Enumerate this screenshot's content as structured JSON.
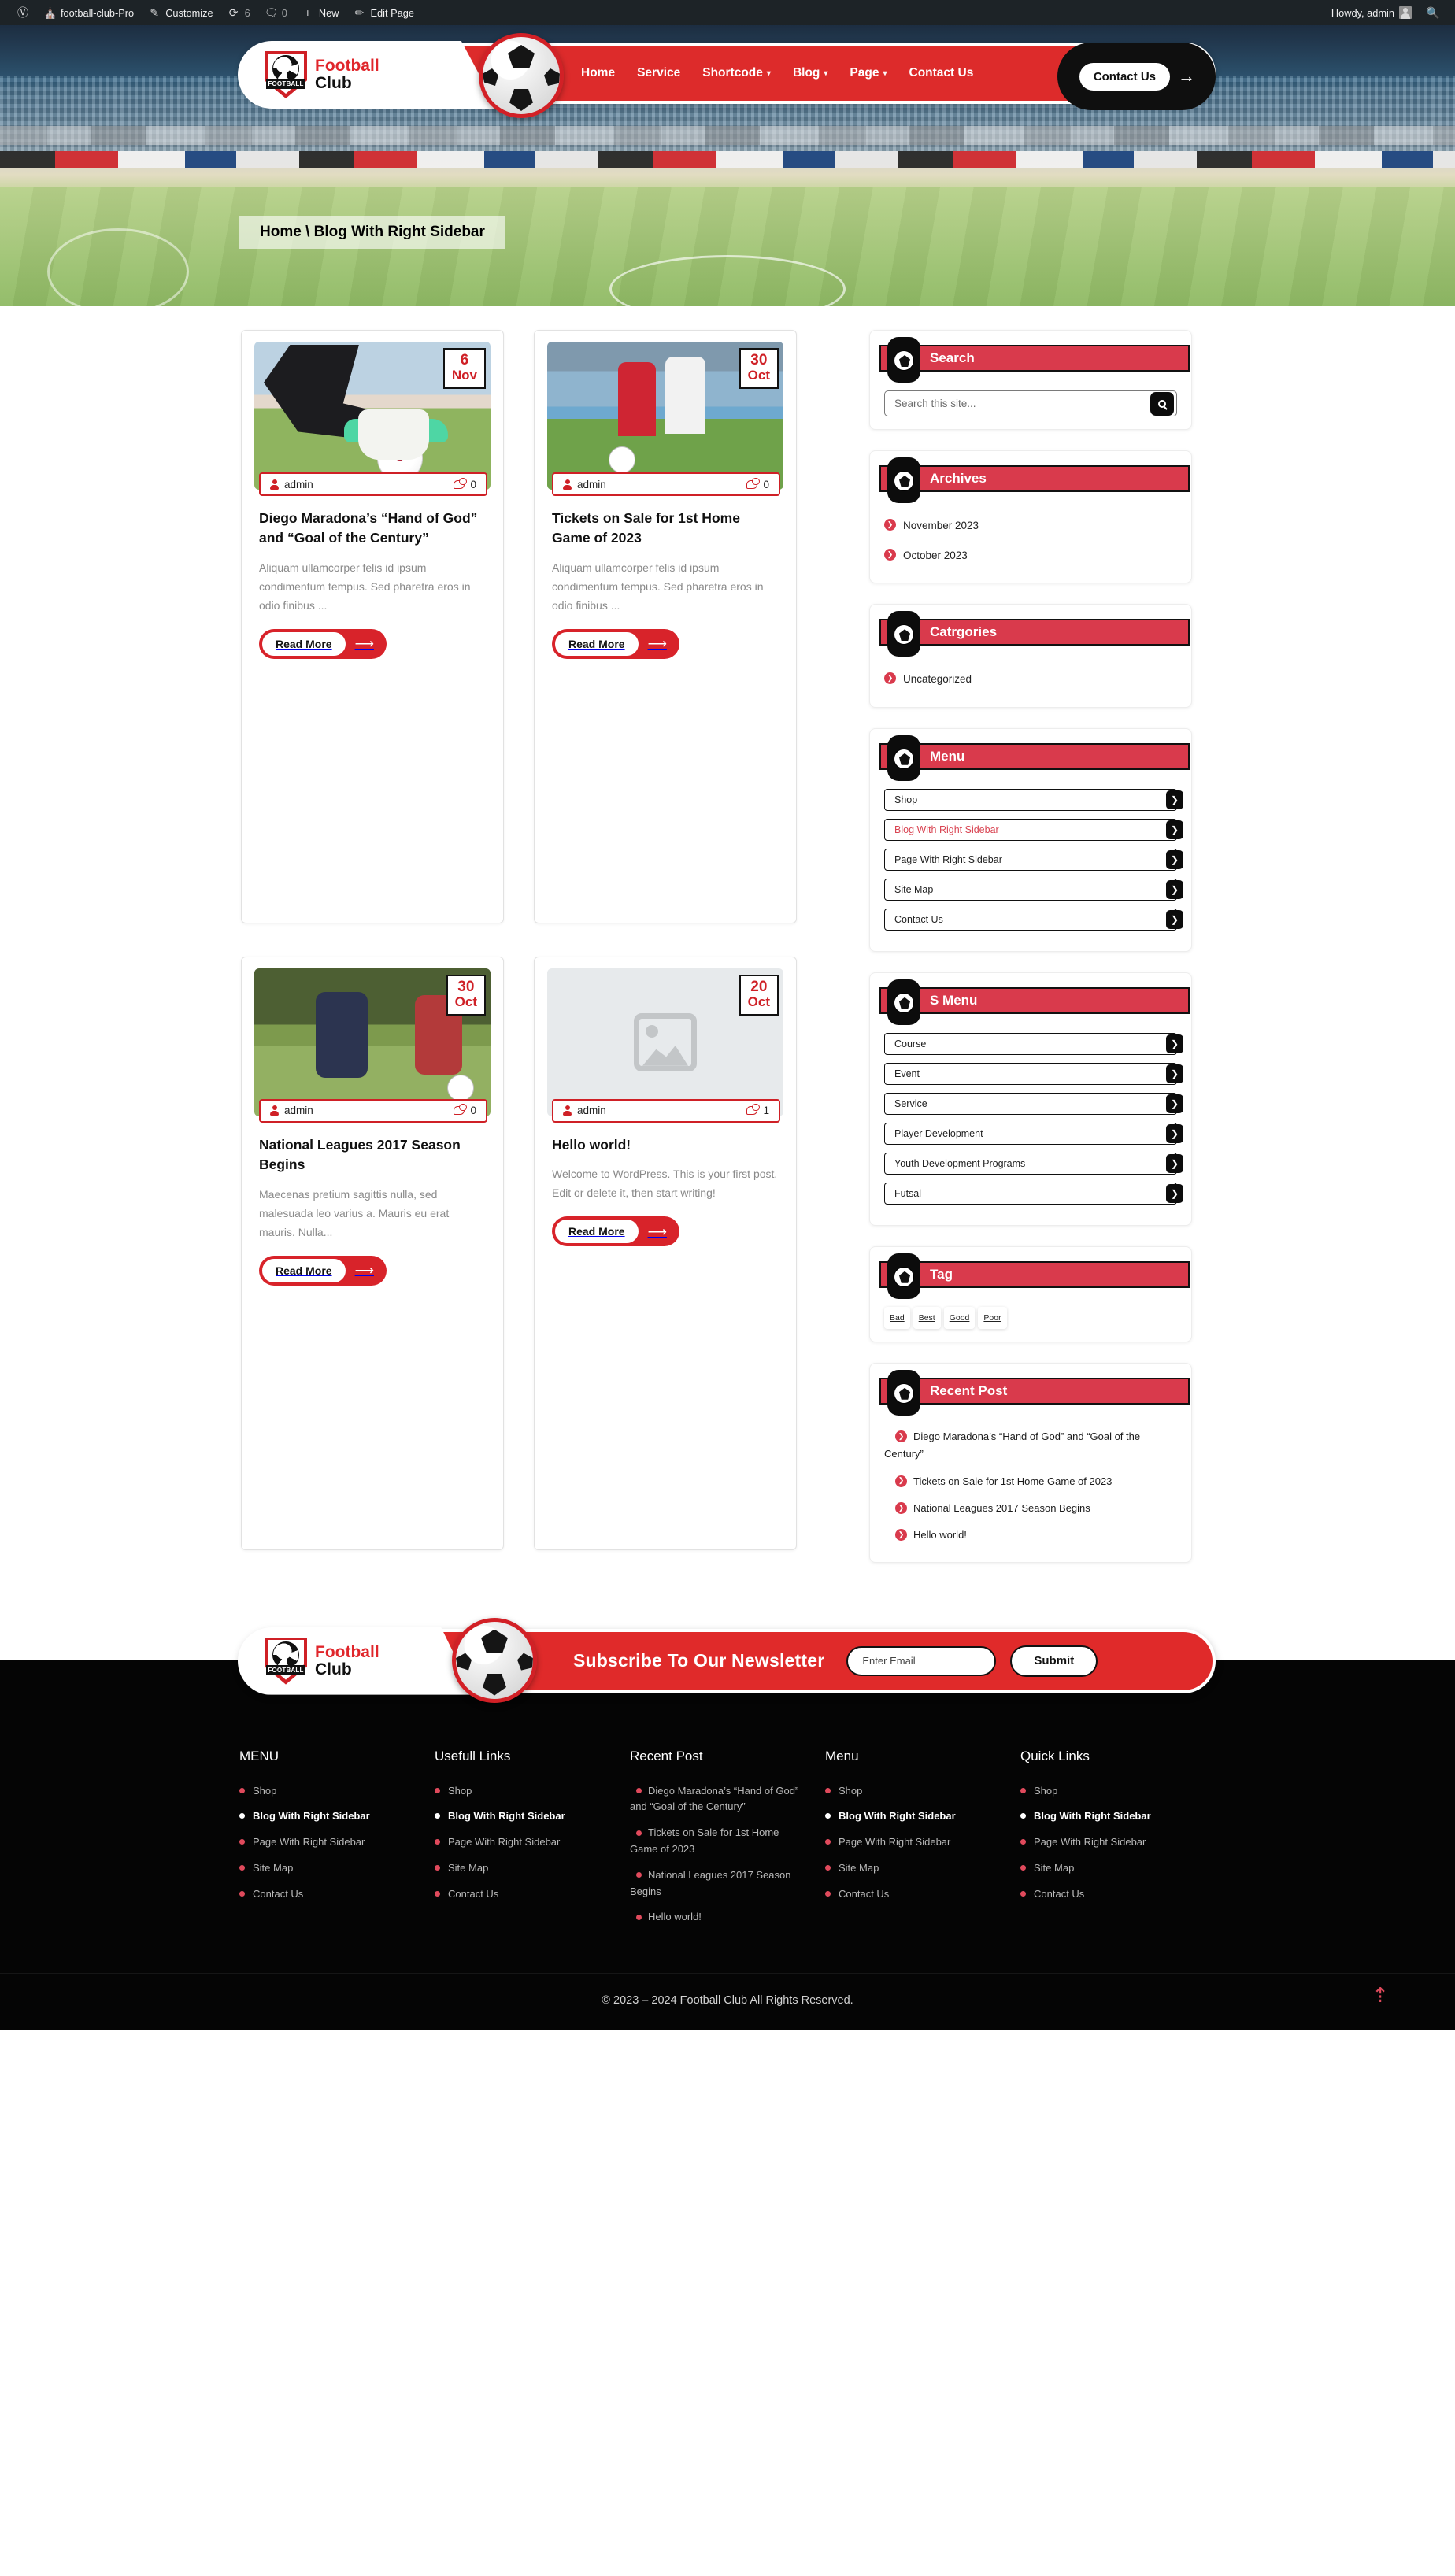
{
  "adminbar": {
    "wp_logo": "wordpress-icon",
    "site_name": "football-club-Pro",
    "customize": "Customize",
    "revisions_count": "6",
    "comments_count": "0",
    "new": "New",
    "edit_page": "Edit Page",
    "howdy": "Howdy, admin",
    "search": "search-icon"
  },
  "header": {
    "logo_line1": "Football",
    "logo_line2": "Club",
    "crest_word": "FOOTBALL",
    "nav": [
      {
        "label": "Home",
        "has_caret": false
      },
      {
        "label": "Service",
        "has_caret": false
      },
      {
        "label": "Shortcode",
        "has_caret": true
      },
      {
        "label": "Blog",
        "has_caret": true
      },
      {
        "label": "Page",
        "has_caret": true
      },
      {
        "label": "Contact Us",
        "has_caret": false
      }
    ],
    "cta_label": "Contact Us",
    "cta_arrow": "→"
  },
  "breadcrumb": "Home \\ Blog With Right Sidebar",
  "posts": [
    {
      "day": "6",
      "month": "Nov",
      "author": "admin",
      "comments": "0",
      "title": "Diego Maradona’s “Hand of God” and “Goal of the Century”",
      "excerpt": "Aliquam ullamcorper felis id ipsum condimentum tempus. Sed pharetra eros in odio finibus ...",
      "read_more": "Read More",
      "arrow": "⟶"
    },
    {
      "day": "30",
      "month": "Oct",
      "author": "admin",
      "comments": "0",
      "title": "Tickets on Sale for 1st Home Game of 2023",
      "excerpt": "Aliquam ullamcorper felis id ipsum condimentum tempus. Sed pharetra eros in odio finibus ...",
      "read_more": "Read More",
      "arrow": "⟶"
    },
    {
      "day": "30",
      "month": "Oct",
      "author": "admin",
      "comments": "0",
      "title": "National Leagues 2017 Season Begins",
      "excerpt": "Maecenas pretium sagittis nulla, sed malesuada leo varius a. Mauris eu erat mauris. Nulla...",
      "read_more": "Read More",
      "arrow": "⟶"
    },
    {
      "day": "20",
      "month": "Oct",
      "author": "admin",
      "comments": "1",
      "title": "Hello world!",
      "excerpt": "Welcome to WordPress. This is your first post. Edit or delete it, then start writing!",
      "read_more": "Read More",
      "arrow": "⟶"
    }
  ],
  "sidebar": {
    "search": {
      "title": "Search",
      "placeholder": "Search this site...",
      "button": "search-icon"
    },
    "archives": {
      "title": "Archives",
      "items": [
        "November 2023",
        "October 2023"
      ]
    },
    "categories": {
      "title": "Catrgories",
      "items": [
        "Uncategorized"
      ]
    },
    "menu": {
      "title": "Menu",
      "items": [
        {
          "label": "Shop",
          "active": false
        },
        {
          "label": "Blog With Right Sidebar",
          "active": true
        },
        {
          "label": "Page With Right Sidebar",
          "active": false
        },
        {
          "label": "Site Map",
          "active": false
        },
        {
          "label": "Contact Us",
          "active": false
        }
      ]
    },
    "smenu": {
      "title": "S Menu",
      "items": [
        {
          "label": "Course"
        },
        {
          "label": "Event"
        },
        {
          "label": "Service"
        },
        {
          "label": "Player Development"
        },
        {
          "label": "Youth Development Programs"
        },
        {
          "label": "Futsal"
        }
      ]
    },
    "tag": {
      "title": "Tag",
      "items": [
        "Bad",
        "Best",
        "Good",
        "Poor"
      ]
    },
    "recent": {
      "title": "Recent Post",
      "items": [
        "Diego Maradona’s “Hand of God” and “Goal of the Century”",
        "Tickets on Sale for 1st Home Game of 2023",
        "National Leagues 2017 Season Begins",
        "Hello world!"
      ]
    }
  },
  "newsletter": {
    "logo_line1": "Football",
    "logo_line2": "Club",
    "title": "Subscribe To Our Newsletter",
    "email_placeholder": "Enter Email",
    "submit": "Submit"
  },
  "footer": {
    "columns": [
      {
        "heading": "MENU",
        "items": [
          {
            "label": "Shop",
            "current": false
          },
          {
            "label": "Blog With Right Sidebar",
            "current": true
          },
          {
            "label": "Page With Right Sidebar",
            "current": false
          },
          {
            "label": "Site Map",
            "current": false
          },
          {
            "label": "Contact Us",
            "current": false
          }
        ]
      },
      {
        "heading": "Usefull Links",
        "items": [
          {
            "label": "Shop",
            "current": false
          },
          {
            "label": "Blog With Right Sidebar",
            "current": true
          },
          {
            "label": "Page With Right Sidebar",
            "current": false
          },
          {
            "label": "Site Map",
            "current": false
          },
          {
            "label": "Contact Us",
            "current": false
          }
        ]
      },
      {
        "heading": "Recent Post",
        "recent": true,
        "items": [
          {
            "label": "Diego Maradona’s “Hand of God” and “Goal of the Century”",
            "current": false
          },
          {
            "label": "Tickets on Sale for 1st Home Game of 2023",
            "current": false
          },
          {
            "label": "National Leagues 2017 Season Begins",
            "current": false
          },
          {
            "label": "Hello world!",
            "current": false
          }
        ]
      },
      {
        "heading": "Menu",
        "items": [
          {
            "label": "Shop",
            "current": false
          },
          {
            "label": "Blog With Right Sidebar",
            "current": true
          },
          {
            "label": "Page With Right Sidebar",
            "current": false
          },
          {
            "label": "Site Map",
            "current": false
          },
          {
            "label": "Contact Us",
            "current": false
          }
        ]
      },
      {
        "heading": "Quick Links",
        "items": [
          {
            "label": "Shop",
            "current": false
          },
          {
            "label": "Blog With Right Sidebar",
            "current": true
          },
          {
            "label": "Page With Right Sidebar",
            "current": false
          },
          {
            "label": "Site Map",
            "current": false
          },
          {
            "label": "Contact Us",
            "current": false
          }
        ]
      }
    ],
    "copyright": "© 2023 – 2024 Football Club All Rights Reserved.",
    "to_top": "scroll-to-top-icon"
  },
  "colors": {
    "brand_red": "#d8232a",
    "widget_red": "#d93a4c",
    "header_red": "#dd2b2b",
    "black": "#0c0c0c",
    "adminbar": "#1d2327"
  }
}
